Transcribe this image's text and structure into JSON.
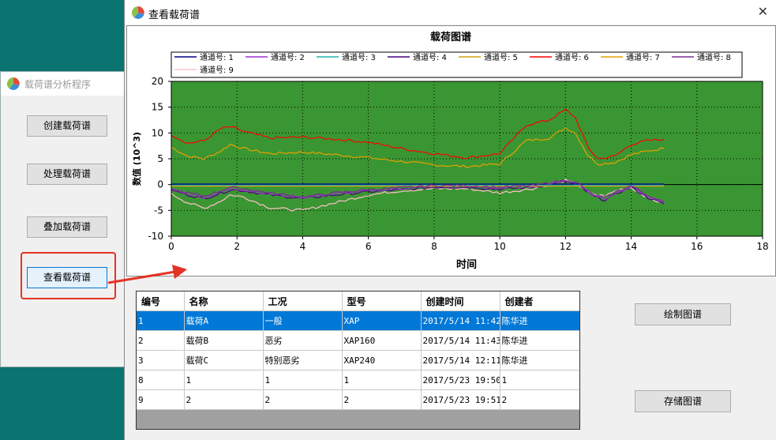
{
  "back_window": {
    "title": "载荷谱分析程序",
    "buttons": [
      "创建载荷谱",
      "处理载荷谱",
      "叠加载荷谱",
      "查看载荷谱"
    ]
  },
  "main_window": {
    "title": "查看载荷谱",
    "close_glyph": "✕",
    "actions": {
      "draw": "绘制图谱",
      "save": "存储图谱"
    }
  },
  "colors": {
    "plot_bg": "#3a9632",
    "selection": "#0078d7",
    "highlight": "#e53224"
  },
  "chart_data": {
    "type": "line",
    "title": "载荷图谱",
    "xlabel": "时间",
    "ylabel": "数值 (10^3)",
    "xlim": [
      0,
      18
    ],
    "ylim": [
      -10,
      20
    ],
    "x_ticks": [
      0,
      2,
      4,
      6,
      8,
      10,
      12,
      14,
      16,
      18
    ],
    "y_ticks": [
      -10,
      -5,
      0,
      5,
      10,
      15,
      20
    ],
    "grid": true,
    "legend_position": "top",
    "series": [
      {
        "name": "通道号: 1",
        "color": "#00008b",
        "x": [
          0,
          15
        ],
        "y": [
          0.1,
          0.1
        ]
      },
      {
        "name": "通道号: 2",
        "color": "#9932cc",
        "x": [
          0,
          0.5,
          1,
          1.5,
          1.8,
          2.2,
          3,
          4,
          5,
          6,
          7,
          8,
          9,
          10,
          11,
          11.5,
          12,
          12.4,
          12.8,
          13.2,
          13.6,
          14,
          14.5,
          15
        ],
        "y": [
          -0.8,
          -1.8,
          -2.5,
          -1.5,
          -0.8,
          -1.0,
          -1.8,
          -2.5,
          -1.8,
          -1.2,
          -0.8,
          -0.3,
          -0.3,
          -0.7,
          -0.3,
          0.2,
          0.8,
          0.1,
          -2.0,
          -2.8,
          -1.4,
          -0.3,
          -2.3,
          -3.6
        ]
      },
      {
        "name": "通道号: 3",
        "color": "#20b2aa",
        "x": [
          0,
          15
        ],
        "y": [
          -0.1,
          -0.1
        ]
      },
      {
        "name": "通道号: 4",
        "color": "#4b0082",
        "x": [
          0,
          0.5,
          1,
          1.5,
          1.8,
          2.2,
          3,
          4,
          5,
          6,
          7,
          8,
          9,
          10,
          11,
          11.5,
          12,
          12.4,
          12.8,
          13.2,
          13.6,
          14,
          14.5,
          15
        ],
        "y": [
          -1.0,
          -2.0,
          -2.7,
          -1.7,
          -1.0,
          -1.2,
          -2.0,
          -2.7,
          -2.0,
          -1.4,
          -1.0,
          -0.5,
          -0.5,
          -0.9,
          -0.5,
          0.0,
          0.6,
          -0.1,
          -2.2,
          -3.0,
          -1.6,
          -0.5,
          -2.5,
          -3.8
        ]
      },
      {
        "name": "通道号: 5",
        "color": "#d4a017",
        "x": [
          0,
          15
        ],
        "y": [
          -0.3,
          -0.3
        ]
      },
      {
        "name": "通道号: 6",
        "color": "#ff0000",
        "x": [
          0,
          0.5,
          1,
          1.5,
          1.8,
          2.2,
          3,
          4,
          5,
          6,
          7,
          8,
          9,
          10,
          10.8,
          11.5,
          12,
          12.3,
          12.7,
          13,
          13.5,
          14,
          14.5,
          15
        ],
        "y": [
          9.7,
          8.0,
          8.5,
          10.8,
          11.2,
          10.3,
          9.0,
          9.2,
          8.8,
          8.2,
          7.0,
          6.0,
          5.2,
          6.0,
          11.5,
          12.5,
          14.5,
          13.0,
          7.0,
          5.0,
          5.5,
          7.8,
          8.5,
          8.8
        ]
      },
      {
        "name": "通道号: 7",
        "color": "#e8a000",
        "x": [
          0,
          0.5,
          1,
          1.5,
          1.8,
          2.2,
          3,
          4,
          5,
          6,
          7,
          8,
          9,
          10,
          10.8,
          11.5,
          12,
          12.3,
          12.7,
          13,
          13.5,
          14,
          14.5,
          15
        ],
        "y": [
          7.2,
          5.5,
          5.0,
          6.5,
          7.8,
          7.0,
          6.0,
          6.3,
          5.8,
          5.2,
          4.5,
          3.8,
          3.5,
          4.0,
          8.5,
          9.0,
          11.0,
          10.0,
          5.5,
          4.0,
          4.3,
          5.8,
          6.5,
          7.0
        ]
      },
      {
        "name": "通道号: 8",
        "color": "#7b2d8e",
        "x": [
          0,
          0.5,
          1,
          1.5,
          1.8,
          2.2,
          3,
          4,
          5,
          6,
          7,
          8,
          9,
          10,
          11,
          11.5,
          12,
          12.4,
          12.8,
          13.2,
          13.6,
          14,
          14.5,
          15
        ],
        "y": [
          -1.0,
          -1.6,
          -2.2,
          -1.2,
          -0.5,
          -0.8,
          -1.6,
          -2.4,
          -1.6,
          -1.0,
          -0.6,
          -0.2,
          -0.2,
          -0.5,
          -0.2,
          0.3,
          0.9,
          0.2,
          -1.8,
          -2.6,
          -1.2,
          -0.2,
          -2.1,
          -3.4
        ]
      },
      {
        "name": "通道号: 9",
        "color": "#ffc0cb",
        "x": [
          0,
          0.5,
          1,
          1.5,
          1.8,
          2.2,
          3,
          4,
          5,
          6,
          7,
          8,
          9,
          10,
          11,
          11.5,
          12,
          12.4,
          12.8,
          13.2,
          13.6,
          14,
          14.5,
          15
        ],
        "y": [
          -1.8,
          -3.5,
          -4.6,
          -3.2,
          -2.0,
          -2.4,
          -4.5,
          -5.0,
          -3.5,
          -2.0,
          -1.2,
          -0.8,
          -0.8,
          -1.6,
          -0.8,
          0.0,
          0.8,
          -0.2,
          -1.8,
          -2.2,
          -1.0,
          -0.6,
          -2.5,
          -3.8
        ]
      }
    ]
  },
  "table": {
    "columns": [
      "编号",
      "名称",
      "工况",
      "型号",
      "创建时间",
      "创建者"
    ],
    "rows": [
      [
        "1",
        "载荷A",
        "一般",
        "XAP",
        "2017/5/14 11:42",
        "陈华进"
      ],
      [
        "2",
        "载荷B",
        "恶劣",
        "XAP160",
        "2017/5/14 11:43",
        "陈华进"
      ],
      [
        "3",
        "载荷C",
        "特别恶劣",
        "XAP240",
        "2017/5/14 12:11",
        "陈华进"
      ],
      [
        "8",
        "1",
        "1",
        "1",
        "2017/5/23 19:50",
        "1"
      ],
      [
        "9",
        "2",
        "2",
        "2",
        "2017/5/23 19:51",
        "2"
      ]
    ],
    "selected_row": 0
  }
}
